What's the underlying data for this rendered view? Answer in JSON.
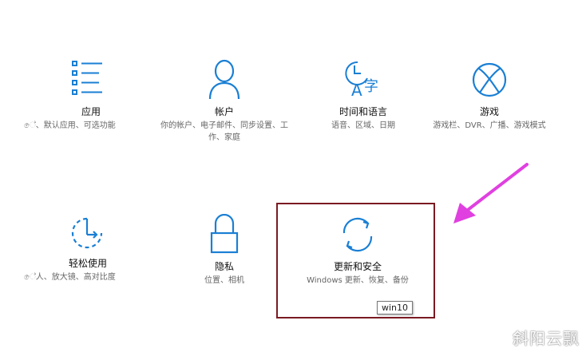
{
  "tiles": {
    "apps": {
      "title": "应用",
      "desc": "ේ、默认应用、可选功能"
    },
    "accounts": {
      "title": "帐户",
      "desc": "你的帐户、电子邮件、同步设置、工作、家庭"
    },
    "time": {
      "title": "时间和语言",
      "desc": "语音、区域、日期"
    },
    "gaming": {
      "title": "游戏",
      "desc": "游戏栏、DVR、广播、游戏模式"
    },
    "ease": {
      "title": "轻松使用",
      "desc": "ේ人、放大镜、高对比度"
    },
    "privacy": {
      "title": "隐私",
      "desc": "位置、相机"
    },
    "update": {
      "title": "更新和安全",
      "desc": "Windows 更新、恢复、备份"
    }
  },
  "tooltip": "win10",
  "watermark": "斜阳云飘",
  "colors": {
    "accent": "#1a7fd4",
    "highlight": "#7a1a22",
    "arrow": "#e040e0"
  }
}
